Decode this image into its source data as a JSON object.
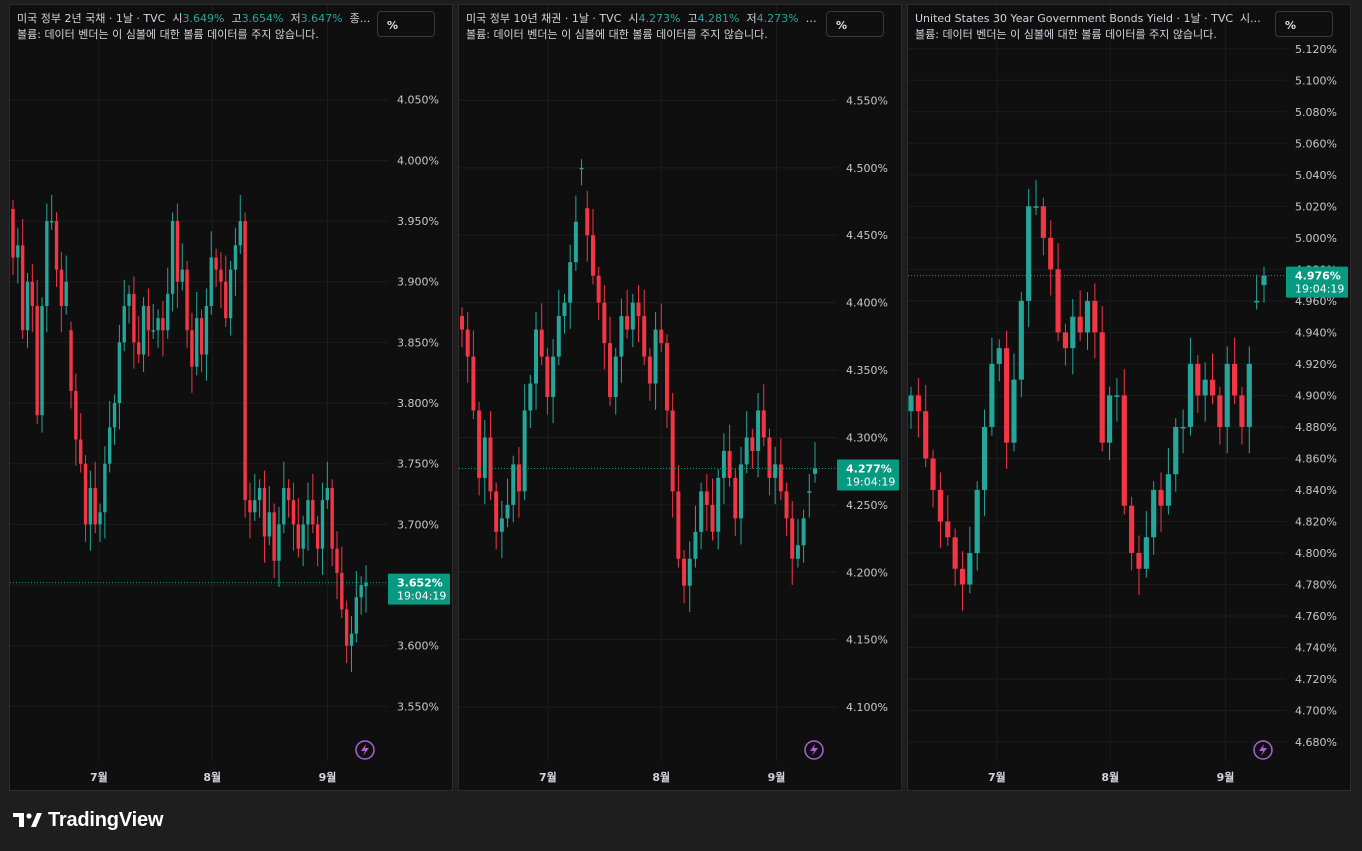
{
  "brand": "TradingView",
  "colors": {
    "up": "#26a69a",
    "down": "#f23645",
    "label_bg": "#089981",
    "grid": "#1c1c1c",
    "text": "#d1d4dc"
  },
  "volume_note": "볼륨: 데이터 벤더는 이 심볼에 대한 볼륨 데이터를 주지 않습니다.",
  "flash_icon": "lightning-circle-icon",
  "chart_data": [
    {
      "type": "candlestick",
      "title": "미국 정부 2년 국채 · 1날 · TVC",
      "ohlc_text": {
        "open_label": "시",
        "open": "3.649%",
        "high_label": "고",
        "high": "3.654%",
        "low_label": "저",
        "low": "3.647%",
        "close_label": "종..."
      },
      "unit_button": "%",
      "y_ticks": [
        "4.050%",
        "4.000%",
        "3.950%",
        "3.900%",
        "3.850%",
        "3.800%",
        "3.750%",
        "3.700%",
        "3.650%",
        "3.600%",
        "3.550%"
      ],
      "y_tick_values": [
        4.05,
        4.0,
        3.95,
        3.9,
        3.85,
        3.8,
        3.75,
        3.7,
        3.65,
        3.6,
        3.55
      ],
      "x_ticks": [
        "7월",
        "8월",
        "9월"
      ],
      "ylim": [
        3.505,
        4.105
      ],
      "last_price": "3.652%",
      "last_value": 3.652,
      "countdown": "19:04:19",
      "candles_close": [
        3.92,
        3.93,
        3.86,
        3.9,
        3.88,
        3.79,
        3.88,
        3.95,
        3.95,
        3.91,
        3.88,
        3.9,
        3.81,
        3.77,
        3.75,
        3.7,
        3.73,
        3.7,
        3.71,
        3.75,
        3.78,
        3.8,
        3.85,
        3.88,
        3.89,
        3.85,
        3.84,
        3.88,
        3.86,
        3.86,
        3.87,
        3.86,
        3.89,
        3.95,
        3.9,
        3.91,
        3.86,
        3.83,
        3.87,
        3.84,
        3.88,
        3.92,
        3.91,
        3.9,
        3.87,
        3.91,
        3.93,
        3.95,
        3.72,
        3.71,
        3.72,
        3.73,
        3.69,
        3.71,
        3.67,
        3.7,
        3.73,
        3.72,
        3.7,
        3.68,
        3.7,
        3.72,
        3.7,
        3.68,
        3.72,
        3.73,
        3.68,
        3.66,
        3.63,
        3.6,
        3.61,
        3.64,
        3.65,
        3.652
      ],
      "candles_open": [
        3.96,
        3.92,
        3.93,
        3.86,
        3.9,
        3.88,
        3.79,
        3.88,
        3.95,
        3.95,
        3.91,
        3.88,
        3.86,
        3.81,
        3.77,
        3.75,
        3.7,
        3.73,
        3.7,
        3.71,
        3.75,
        3.78,
        3.8,
        3.85,
        3.88,
        3.89,
        3.85,
        3.84,
        3.88,
        3.86,
        3.86,
        3.87,
        3.86,
        3.89,
        3.95,
        3.9,
        3.91,
        3.86,
        3.83,
        3.87,
        3.84,
        3.88,
        3.92,
        3.91,
        3.9,
        3.87,
        3.91,
        3.93,
        3.95,
        3.72,
        3.71,
        3.72,
        3.73,
        3.69,
        3.71,
        3.67,
        3.7,
        3.73,
        3.72,
        3.7,
        3.68,
        3.7,
        3.72,
        3.7,
        3.68,
        3.72,
        3.73,
        3.68,
        3.66,
        3.63,
        3.6,
        3.61,
        3.64,
        3.649
      ]
    },
    {
      "type": "candlestick",
      "title": "미국 정부 10년 채권 · 1날 · TVC",
      "ohlc_text": {
        "open_label": "시",
        "open": "4.273%",
        "high_label": "고",
        "high": "4.281%",
        "low_label": "저",
        "low": "4.273%",
        "close_label": "종..."
      },
      "unit_button": "%",
      "y_ticks": [
        "4.550%",
        "4.500%",
        "4.450%",
        "4.400%",
        "4.350%",
        "4.300%",
        "4.250%",
        "4.200%",
        "4.150%",
        "4.100%"
      ],
      "y_tick_values": [
        4.55,
        4.5,
        4.45,
        4.4,
        4.35,
        4.3,
        4.25,
        4.2,
        4.15,
        4.1
      ],
      "x_ticks": [
        "7월",
        "8월",
        "9월"
      ],
      "ylim": [
        4.06,
        4.6
      ],
      "last_price": "4.277%",
      "last_value": 4.277,
      "countdown": "19:04:19",
      "candles_close": [
        4.38,
        4.36,
        4.32,
        4.27,
        4.3,
        4.26,
        4.23,
        4.24,
        4.25,
        4.28,
        4.26,
        4.32,
        4.34,
        4.38,
        4.36,
        4.33,
        4.36,
        4.39,
        4.4,
        4.43,
        4.46,
        4.5,
        4.45,
        4.42,
        4.4,
        4.37,
        4.33,
        4.36,
        4.39,
        4.38,
        4.4,
        4.39,
        4.36,
        4.34,
        4.38,
        4.37,
        4.32,
        4.26,
        4.21,
        4.19,
        4.21,
        4.23,
        4.26,
        4.25,
        4.23,
        4.27,
        4.29,
        4.27,
        4.24,
        4.28,
        4.3,
        4.29,
        4.32,
        4.3,
        4.27,
        4.28,
        4.26,
        4.24,
        4.21,
        4.22,
        4.24,
        4.26,
        4.277
      ],
      "candles_open": [
        4.39,
        4.38,
        4.36,
        4.32,
        4.27,
        4.3,
        4.26,
        4.23,
        4.24,
        4.25,
        4.28,
        4.26,
        4.32,
        4.34,
        4.38,
        4.36,
        4.33,
        4.36,
        4.39,
        4.4,
        4.43,
        4.5,
        4.47,
        4.45,
        4.42,
        4.4,
        4.37,
        4.33,
        4.36,
        4.39,
        4.38,
        4.4,
        4.39,
        4.36,
        4.34,
        4.38,
        4.37,
        4.32,
        4.26,
        4.21,
        4.19,
        4.21,
        4.23,
        4.26,
        4.25,
        4.23,
        4.27,
        4.29,
        4.27,
        4.24,
        4.28,
        4.3,
        4.29,
        4.32,
        4.3,
        4.27,
        4.28,
        4.26,
        4.24,
        4.21,
        4.22,
        4.26,
        4.273
      ]
    },
    {
      "type": "candlestick",
      "title": "United States 30 Year Government Bonds Yield · 1날 · TVC",
      "ohlc_text": {
        "open_label": "시...",
        "open": "",
        "high_label": "",
        "high": "",
        "low_label": "",
        "low": "",
        "close_label": ""
      },
      "unit_button": "%",
      "y_ticks": [
        "5.120%",
        "5.100%",
        "5.080%",
        "5.060%",
        "5.040%",
        "5.020%",
        "5.000%",
        "4.980%",
        "4.960%",
        "4.940%",
        "4.920%",
        "4.900%",
        "4.880%",
        "4.860%",
        "4.840%",
        "4.820%",
        "4.800%",
        "4.780%",
        "4.760%",
        "4.740%",
        "4.720%",
        "4.700%",
        "4.680%"
      ],
      "y_tick_values": [
        5.12,
        5.1,
        5.08,
        5.06,
        5.04,
        5.02,
        5.0,
        4.98,
        4.96,
        4.94,
        4.92,
        4.9,
        4.88,
        4.86,
        4.84,
        4.82,
        4.8,
        4.78,
        4.76,
        4.74,
        4.72,
        4.7,
        4.68
      ],
      "x_ticks": [
        "7월",
        "8월",
        "9월"
      ],
      "ylim": [
        4.668,
        5.13
      ],
      "last_price": "4.976%",
      "last_value": 4.976,
      "countdown": "19:04:19",
      "candles_close": [
        4.9,
        4.89,
        4.86,
        4.84,
        4.82,
        4.81,
        4.79,
        4.78,
        4.8,
        4.84,
        4.88,
        4.92,
        4.93,
        4.87,
        4.91,
        4.96,
        5.02,
        5.02,
        5.0,
        4.98,
        4.94,
        4.93,
        4.95,
        4.94,
        4.96,
        4.94,
        4.87,
        4.9,
        4.9,
        4.83,
        4.8,
        4.79,
        4.81,
        4.84,
        4.83,
        4.85,
        4.88,
        4.88,
        4.92,
        4.9,
        4.91,
        4.9,
        4.88,
        4.92,
        4.9,
        4.88,
        4.92,
        4.96,
        4.976
      ],
      "candles_open": [
        4.89,
        4.9,
        4.89,
        4.86,
        4.84,
        4.82,
        4.81,
        4.79,
        4.78,
        4.8,
        4.84,
        4.88,
        4.92,
        4.93,
        4.87,
        4.91,
        4.96,
        5.02,
        5.02,
        5.0,
        4.98,
        4.94,
        4.93,
        4.95,
        4.94,
        4.96,
        4.94,
        4.87,
        4.9,
        4.9,
        4.83,
        4.8,
        4.79,
        4.81,
        4.84,
        4.83,
        4.85,
        4.88,
        4.88,
        4.92,
        4.9,
        4.91,
        4.9,
        4.88,
        4.92,
        4.9,
        4.88,
        4.96,
        4.97
      ]
    }
  ]
}
